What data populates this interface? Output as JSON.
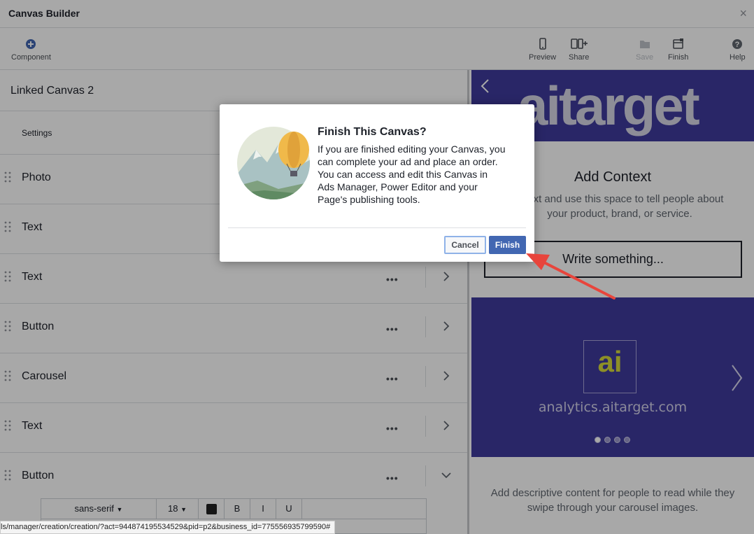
{
  "window": {
    "title": "Canvas Builder",
    "close_label": "×"
  },
  "toolbar": {
    "component_label": "Component",
    "preview_label": "Preview",
    "share_label": "Share",
    "save_label": "Save",
    "finish_label": "Finish",
    "help_label": "Help"
  },
  "left_panel": {
    "canvas_name": "Linked Canvas 2",
    "settings_label": "Settings",
    "components": [
      {
        "label": "Photo"
      },
      {
        "label": "Text"
      },
      {
        "label": "Text"
      },
      {
        "label": "Button"
      },
      {
        "label": "Carousel"
      },
      {
        "label": "Text"
      },
      {
        "label": "Button"
      }
    ],
    "more_label": "•••",
    "editor": {
      "font": "sans-serif",
      "size": "18",
      "bold": "B",
      "italic": "I",
      "underline": "U"
    }
  },
  "preview": {
    "logo_text": "aitarget",
    "heading": "Add Context",
    "subtext": "e text and use this space to tell people about\nyour product, brand, or service.",
    "input_placeholder": "Write something...",
    "carousel": {
      "logo_text": "ai",
      "url": "analytics.aitarget.com",
      "dots": 4,
      "active_dot": 0
    },
    "description": "Add descriptive content for people to read while they\nswipe through your carousel images."
  },
  "dialog": {
    "title": "Finish This Canvas?",
    "body": "If you are finished editing your Canvas, you\ncan complete your ad and place an order.\nYou can access and edit this Canvas in\nAds Manager, Power Editor and your\nPage's publishing tools.",
    "cancel_label": "Cancel",
    "finish_label": "Finish"
  },
  "status_bar": {
    "url": "ls/manager/creation/creation/?act=944874195534529&pid=p2&business_id=775556935799590#"
  },
  "colors": {
    "brand_purple": "#3f3a9d",
    "fb_blue": "#4267b2",
    "arrow_red": "#e8453c"
  }
}
